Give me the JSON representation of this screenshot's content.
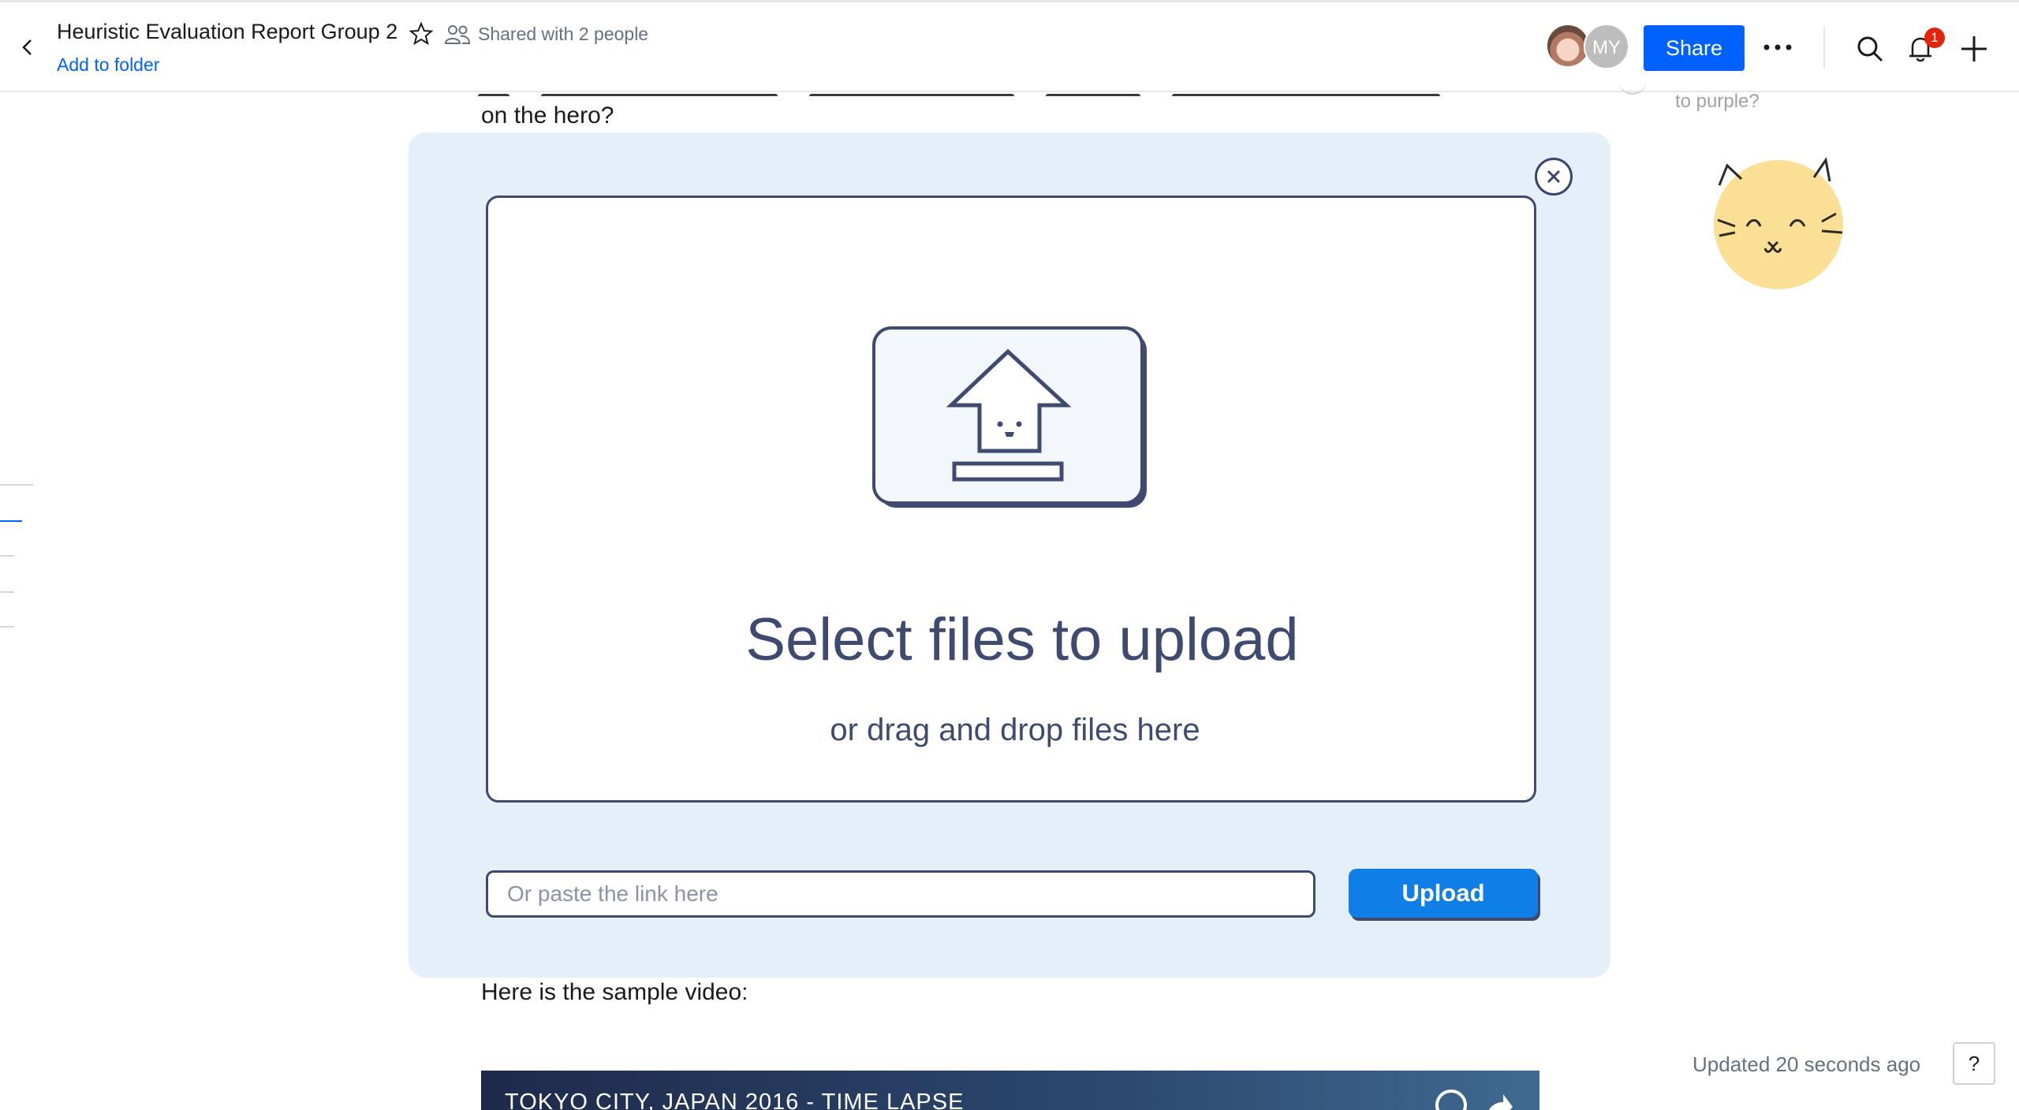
{
  "header": {
    "title": "Heuristic Evaluation Report Group 2",
    "shared_text": "Shared with 2 people",
    "add_to_folder": "Add to folder",
    "avatar_initials": "MY",
    "share_label": "Share",
    "notification_count": "1"
  },
  "document": {
    "line_top": "on the hero?",
    "line_video": "Here is the sample video:",
    "video_title": "TOKYO CITY, JAPAN 2016 - TIME LAPSE"
  },
  "sidebar": {
    "comment_fragment": "to purple?"
  },
  "upload_modal": {
    "title": "Select files to upload",
    "subtitle": "or drag and drop files here",
    "link_placeholder": "Or paste the link here",
    "upload_label": "Upload"
  },
  "footer": {
    "updated_text": "Updated 20 seconds ago",
    "help_label": "?"
  },
  "colors": {
    "brand_blue": "#0061fe",
    "modal_bg": "#e5effa",
    "navy": "#3e4a70",
    "upload_button": "#0f7ee6",
    "badge_red": "#e3230b"
  }
}
